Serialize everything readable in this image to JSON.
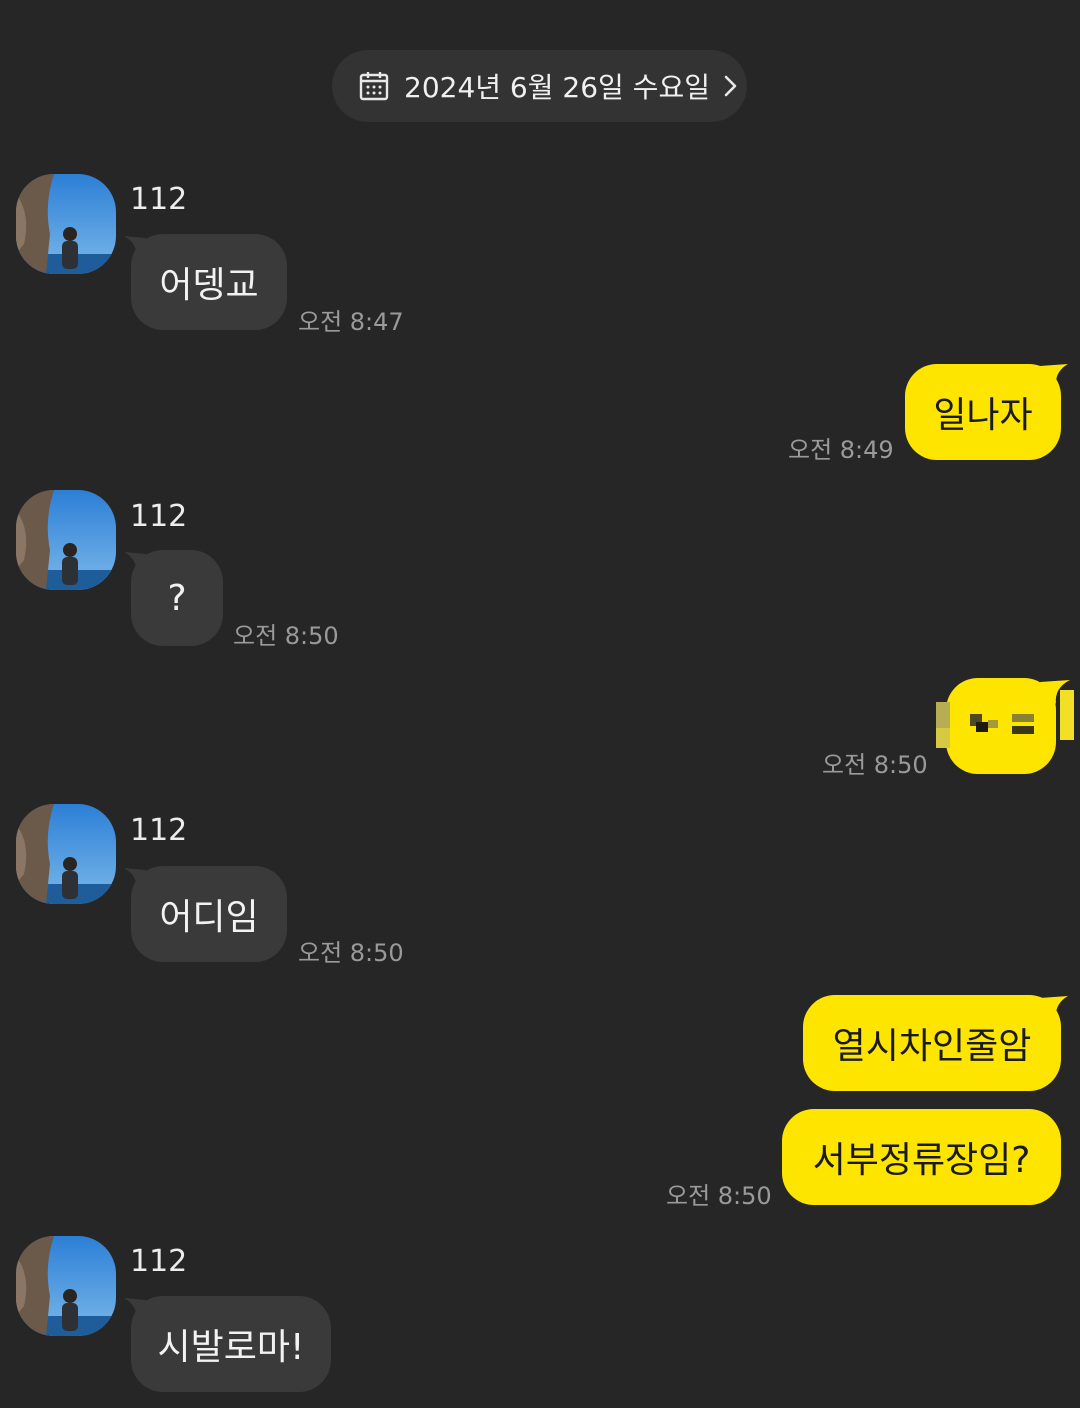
{
  "date_header": {
    "label": "2024년 6월 26일 수요일"
  },
  "messages": [
    {
      "sender": "112",
      "text": "어뎅교",
      "time": "오전 8:47"
    },
    {
      "text": "일나자",
      "time": "오전 8:49"
    },
    {
      "sender": "112",
      "text": "?",
      "time": "오전 8:50"
    },
    {
      "text": "",
      "time": "오전 8:50"
    },
    {
      "sender": "112",
      "text": "어디임",
      "time": "오전 8:50"
    },
    {
      "text": "열시차인줄암"
    },
    {
      "text": "서부정류장임?",
      "time": "오전 8:50"
    },
    {
      "sender": "112",
      "text": "시발로마!"
    }
  ],
  "colors": {
    "background": "#262626",
    "incoming_bubble": "#3a3a3a",
    "outgoing_bubble": "#fee500",
    "timestamp": "#9a9a9a"
  }
}
